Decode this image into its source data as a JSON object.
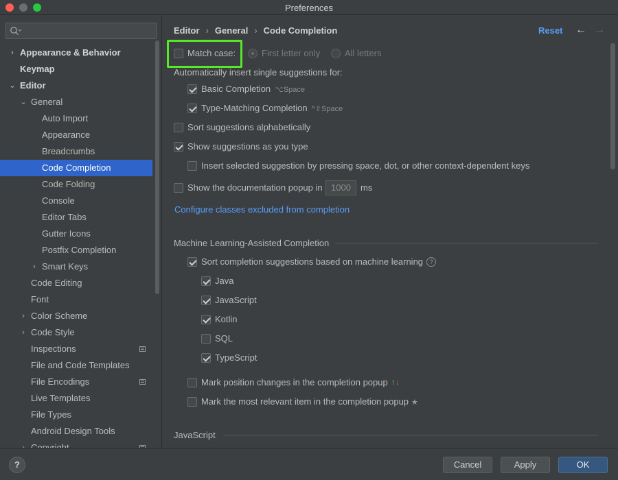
{
  "window": {
    "title": "Preferences"
  },
  "sidebar": {
    "search_placeholder": "",
    "items": [
      {
        "label": "Appearance & Behavior",
        "level": 0,
        "chevron": "›",
        "bold": true
      },
      {
        "label": "Keymap",
        "level": 0,
        "chevron": "",
        "bold": true
      },
      {
        "label": "Editor",
        "level": 0,
        "chevron": "⌄",
        "bold": true
      },
      {
        "label": "General",
        "level": 1,
        "chevron": "⌄"
      },
      {
        "label": "Auto Import",
        "level": 2,
        "chevron": ""
      },
      {
        "label": "Appearance",
        "level": 2,
        "chevron": ""
      },
      {
        "label": "Breadcrumbs",
        "level": 2,
        "chevron": ""
      },
      {
        "label": "Code Completion",
        "level": 2,
        "chevron": "",
        "selected": true
      },
      {
        "label": "Code Folding",
        "level": 2,
        "chevron": ""
      },
      {
        "label": "Console",
        "level": 2,
        "chevron": ""
      },
      {
        "label": "Editor Tabs",
        "level": 2,
        "chevron": ""
      },
      {
        "label": "Gutter Icons",
        "level": 2,
        "chevron": ""
      },
      {
        "label": "Postfix Completion",
        "level": 2,
        "chevron": ""
      },
      {
        "label": "Smart Keys",
        "level": 2,
        "chevron": "›"
      },
      {
        "label": "Code Editing",
        "level": 1,
        "chevron": ""
      },
      {
        "label": "Font",
        "level": 1,
        "chevron": ""
      },
      {
        "label": "Color Scheme",
        "level": 1,
        "chevron": "›"
      },
      {
        "label": "Code Style",
        "level": 1,
        "chevron": "›"
      },
      {
        "label": "Inspections",
        "level": 1,
        "chevron": "",
        "badge": true
      },
      {
        "label": "File and Code Templates",
        "level": 1,
        "chevron": ""
      },
      {
        "label": "File Encodings",
        "level": 1,
        "chevron": "",
        "badge": true
      },
      {
        "label": "Live Templates",
        "level": 1,
        "chevron": ""
      },
      {
        "label": "File Types",
        "level": 1,
        "chevron": ""
      },
      {
        "label": "Android Design Tools",
        "level": 1,
        "chevron": ""
      },
      {
        "label": "Copyright",
        "level": 1,
        "chevron": "›",
        "badge": true
      }
    ]
  },
  "header": {
    "breadcrumb": [
      "Editor",
      "General",
      "Code Completion"
    ],
    "separator": "›",
    "reset": "Reset",
    "back": "←",
    "forward": "→"
  },
  "settings": {
    "match_case": {
      "label": "Match case:",
      "checked": false
    },
    "first_letter": "First letter only",
    "all_letters": "All letters",
    "auto_insert_label": "Automatically insert single suggestions for:",
    "basic_completion": {
      "label": "Basic Completion",
      "shortcut": "⌥Space",
      "checked": true
    },
    "type_matching": {
      "label": "Type-Matching Completion",
      "shortcut": "^⇧Space",
      "checked": true
    },
    "sort_alpha": {
      "label": "Sort suggestions alphabetically",
      "checked": false
    },
    "show_as_you_type": {
      "label": "Show suggestions as you type",
      "checked": true
    },
    "insert_selected": {
      "label": "Insert selected suggestion by pressing space, dot, or other context-dependent keys",
      "checked": false
    },
    "doc_popup": {
      "label": "Show the documentation popup in",
      "value": "1000",
      "unit": "ms",
      "checked": false
    },
    "configure_link": "Configure classes excluded from completion",
    "ml_section": "Machine Learning-Assisted Completion",
    "ml_sort": {
      "label": "Sort completion suggestions based on machine learning",
      "checked": true
    },
    "languages": [
      {
        "label": "Java",
        "checked": true
      },
      {
        "label": "JavaScript",
        "checked": true
      },
      {
        "label": "Kotlin",
        "checked": true
      },
      {
        "label": "SQL",
        "checked": false
      },
      {
        "label": "TypeScript",
        "checked": true
      }
    ],
    "mark_position": {
      "label": "Mark position changes in the completion popup",
      "checked": false
    },
    "mark_relevant": {
      "label": "Mark the most relevant item in the completion popup",
      "checked": false
    },
    "js_section": "JavaScript",
    "help_glyph": "?",
    "up_arrow": "↑",
    "down_arrow": "↓",
    "star_glyph": "★"
  },
  "footer": {
    "help": "?",
    "cancel": "Cancel",
    "apply": "Apply",
    "ok": "OK"
  },
  "colors": {
    "accent": "#2f65ca",
    "link": "#589df6",
    "highlight": "#57e829",
    "up_arrow": "#5fb85f",
    "down_arrow": "#e05252"
  }
}
